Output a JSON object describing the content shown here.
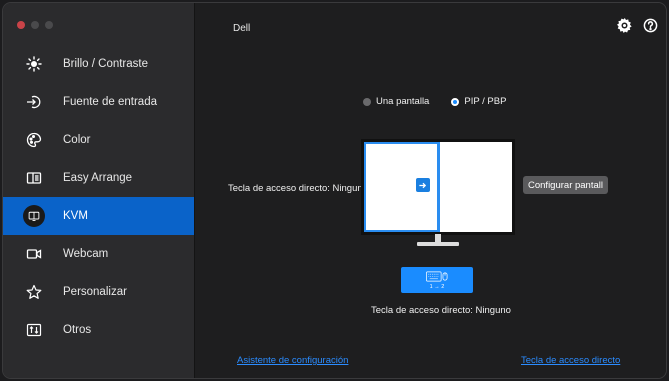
{
  "window": {
    "title": "Dell"
  },
  "sidebar": {
    "items": [
      {
        "label": "Brillo / Contraste",
        "icon": "brightness-icon"
      },
      {
        "label": "Fuente de entrada",
        "icon": "input-source-icon"
      },
      {
        "label": "Color",
        "icon": "color-palette-icon"
      },
      {
        "label": "Easy Arrange",
        "icon": "easy-arrange-icon"
      },
      {
        "label": "KVM",
        "icon": "kvm-icon",
        "active": true
      },
      {
        "label": "Webcam",
        "icon": "webcam-icon"
      },
      {
        "label": "Personalizar",
        "icon": "star-icon"
      },
      {
        "label": "Otros",
        "icon": "others-icon"
      }
    ]
  },
  "mode": {
    "options": [
      {
        "label": "Una pantalla",
        "selected": false
      },
      {
        "label": "PIP / PBP",
        "selected": true
      }
    ]
  },
  "hotkey_left": "Tecla de acceso directo: Ningun",
  "config_button": "Configurar pantall",
  "keyboard_tile": {
    "label": "1 → 2"
  },
  "hotkey_bottom": "Tecla de acceso directo: Ninguno",
  "footer": {
    "left_link": "Asistente de configuración",
    "right_link": "Tecla de acceso directo"
  },
  "colors": {
    "accent": "#0a63c9",
    "link": "#2b8cff",
    "sidebar_bg": "#2b2b2d",
    "main_bg": "#1e1e1f"
  }
}
